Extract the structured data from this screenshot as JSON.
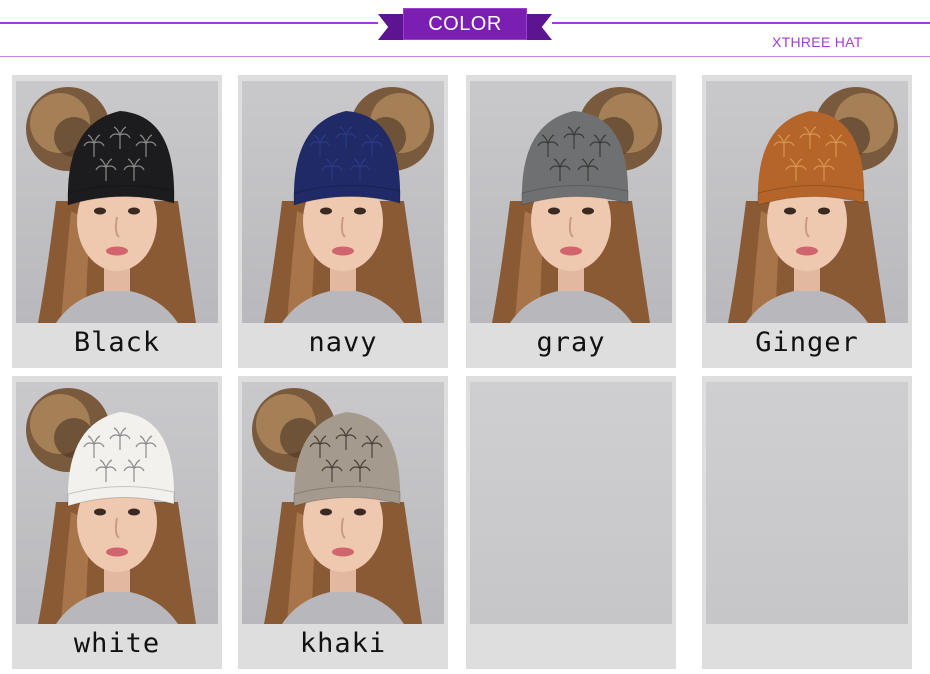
{
  "header": {
    "banner_label": "COLOR",
    "brand": "XTHREE HAT"
  },
  "accent_color": "#a23bd6",
  "banner_color": "#7a1fb2",
  "swatches": [
    {
      "label": "Black",
      "hat_color": "#1c1c1e",
      "pattern_color": "#8a8a8a"
    },
    {
      "label": "navy",
      "hat_color": "#1f2a66",
      "pattern_color": "#2a3a85"
    },
    {
      "label": "gray",
      "hat_color": "#6f7072",
      "pattern_color": "#3a3a3a"
    },
    {
      "label": "Ginger",
      "hat_color": "#b5652a",
      "pattern_color": "#d8954f"
    },
    {
      "label": "white",
      "hat_color": "#f2f1ed",
      "pattern_color": "#8c8c8c"
    },
    {
      "label": "khaki",
      "hat_color": "#a59a8e",
      "pattern_color": "#4a4038"
    }
  ],
  "placeholders": 2
}
